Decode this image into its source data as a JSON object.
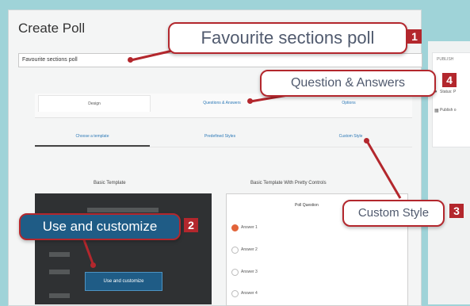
{
  "page": {
    "title": "Create Poll",
    "poll_title_value": "Favourite sections poll"
  },
  "sidebar": {
    "heading": "PUBLISH",
    "lines": [
      "Status: P",
      "Publish o"
    ]
  },
  "tabs": [
    {
      "label": "Design"
    },
    {
      "label": "Questions & Answers"
    },
    {
      "label": "Options"
    }
  ],
  "subtabs": [
    {
      "label": "Choose a template"
    },
    {
      "label": "Predefined Styles"
    },
    {
      "label": "Custom Style"
    }
  ],
  "templates": {
    "basic": {
      "heading": "Basic Template",
      "button": "Use and customize"
    },
    "pretty": {
      "heading": "Basic Template With Pretty Controls",
      "question": "Poll Question",
      "answers": [
        "Answer 1",
        "Answer 2",
        "Answer 3",
        "Answer 4"
      ]
    }
  },
  "callouts": {
    "c1": {
      "text": "Favourite sections poll",
      "num": "1"
    },
    "c2": {
      "text": "Use and customize",
      "num": "2"
    },
    "c3": {
      "text": "Custom Style",
      "num": "3"
    },
    "c4": {
      "text": "Question & Answers",
      "num": "4"
    }
  },
  "colors": {
    "accent": "#b3272d",
    "link": "#2d79b7",
    "button": "#1f5c86",
    "radio_selected": "#e2643a"
  }
}
